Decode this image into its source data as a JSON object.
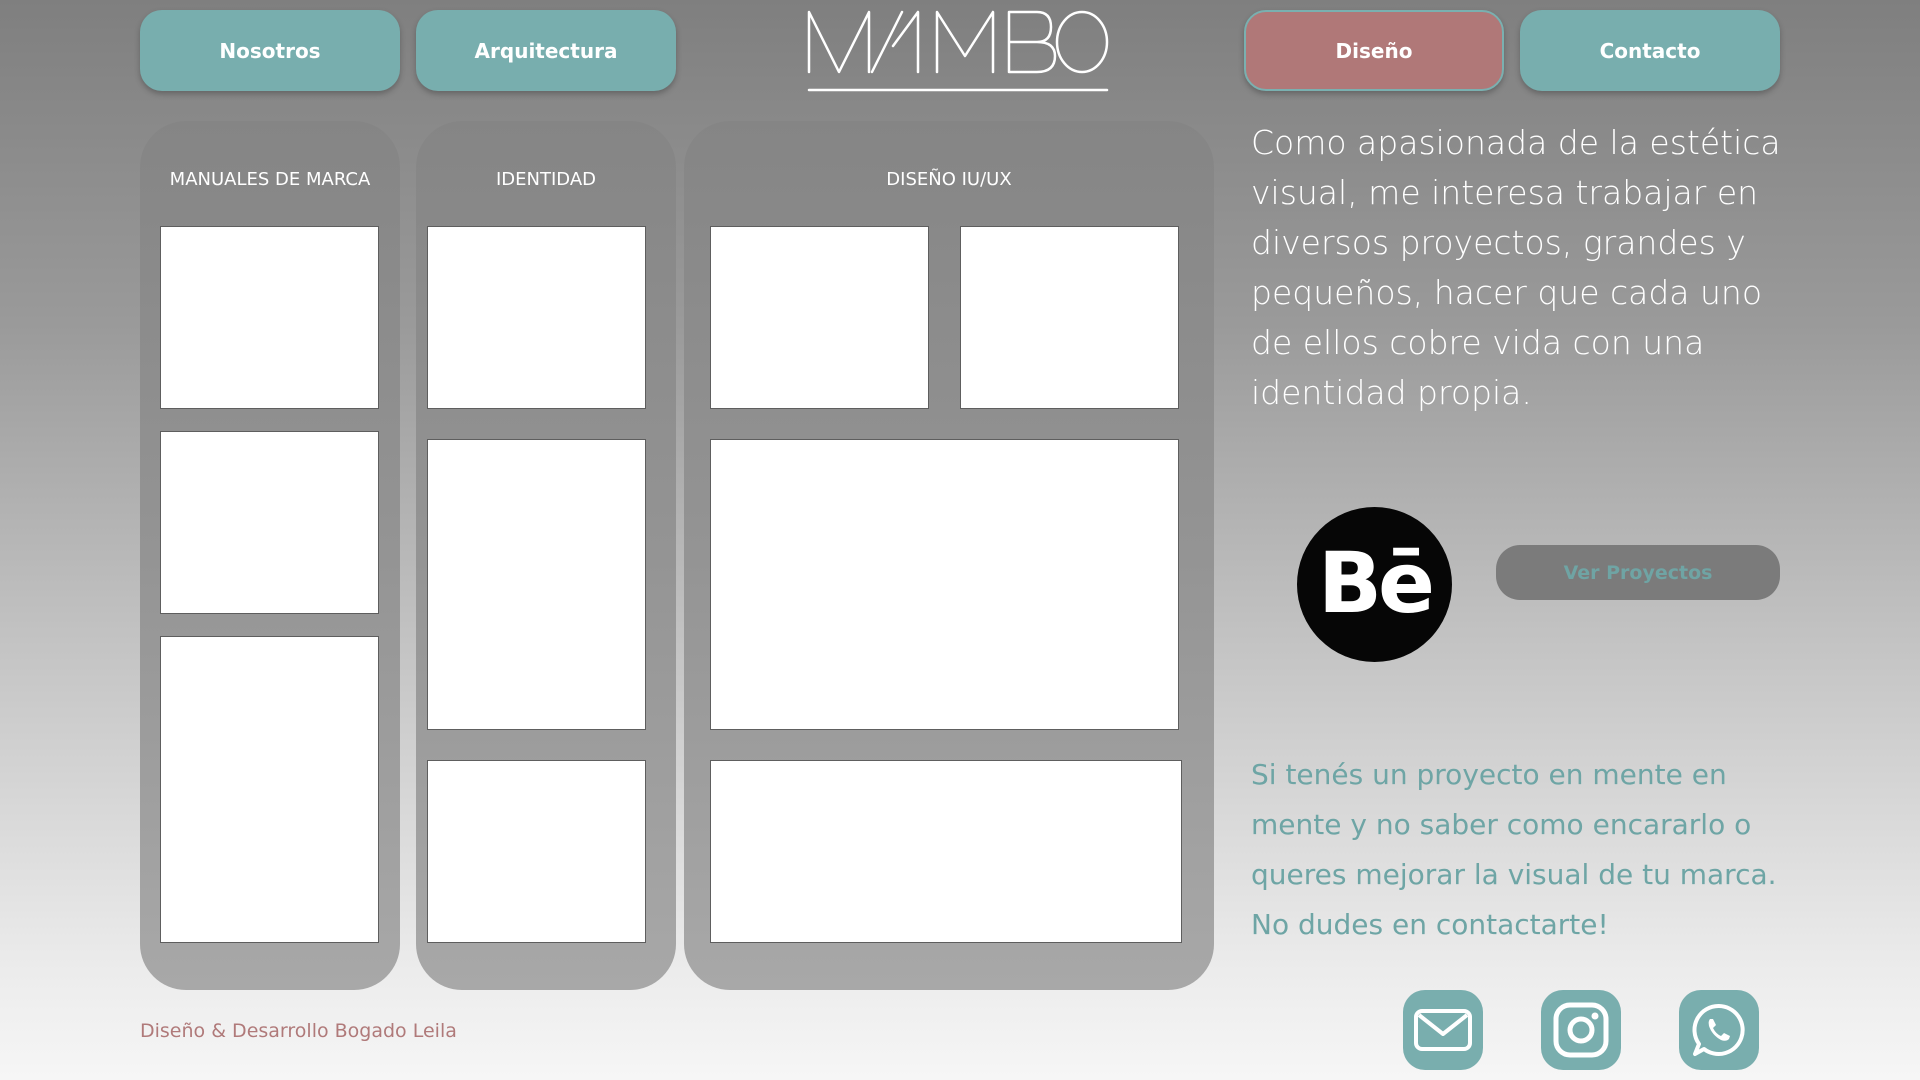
{
  "nav": {
    "nosotros": "Nosotros",
    "arquitectura": "Arquitectura",
    "diseno": "Diseño",
    "contacto": "Contacto"
  },
  "logo": {
    "text": "MAMBO"
  },
  "columns": [
    {
      "title": "MANUALES DE MARCA"
    },
    {
      "title": "IDENTIDAD"
    },
    {
      "title": "DISEÑO IU/UX"
    }
  ],
  "intro_text": "Como apasionada de la estética visual, me interesa trabajar en diversos proyectos, grandes y pequeños, hacer que cada uno de ellos cobre vida con una identidad propia.",
  "behance": {
    "text": "Bē",
    "icon": "behance-icon"
  },
  "projects_button": "Ver  Proyectos",
  "cta_text": "Si tenés un proyecto en mente en mente y no saber como encararlo o queres mejorar la visual de tu marca. No dudes en contactarte!",
  "footer": "Diseño & Desarrollo Bogado Leila",
  "social_icons": [
    "mail-icon",
    "instagram-icon",
    "whatsapp-icon"
  ],
  "colors": {
    "teal": "#78aeae",
    "rose": "#b07878",
    "panel_gray": "#8f8f8f",
    "text_white": "#ffffff",
    "cta_teal": "#6ea5a5",
    "footer_rose": "#b07a7a"
  }
}
